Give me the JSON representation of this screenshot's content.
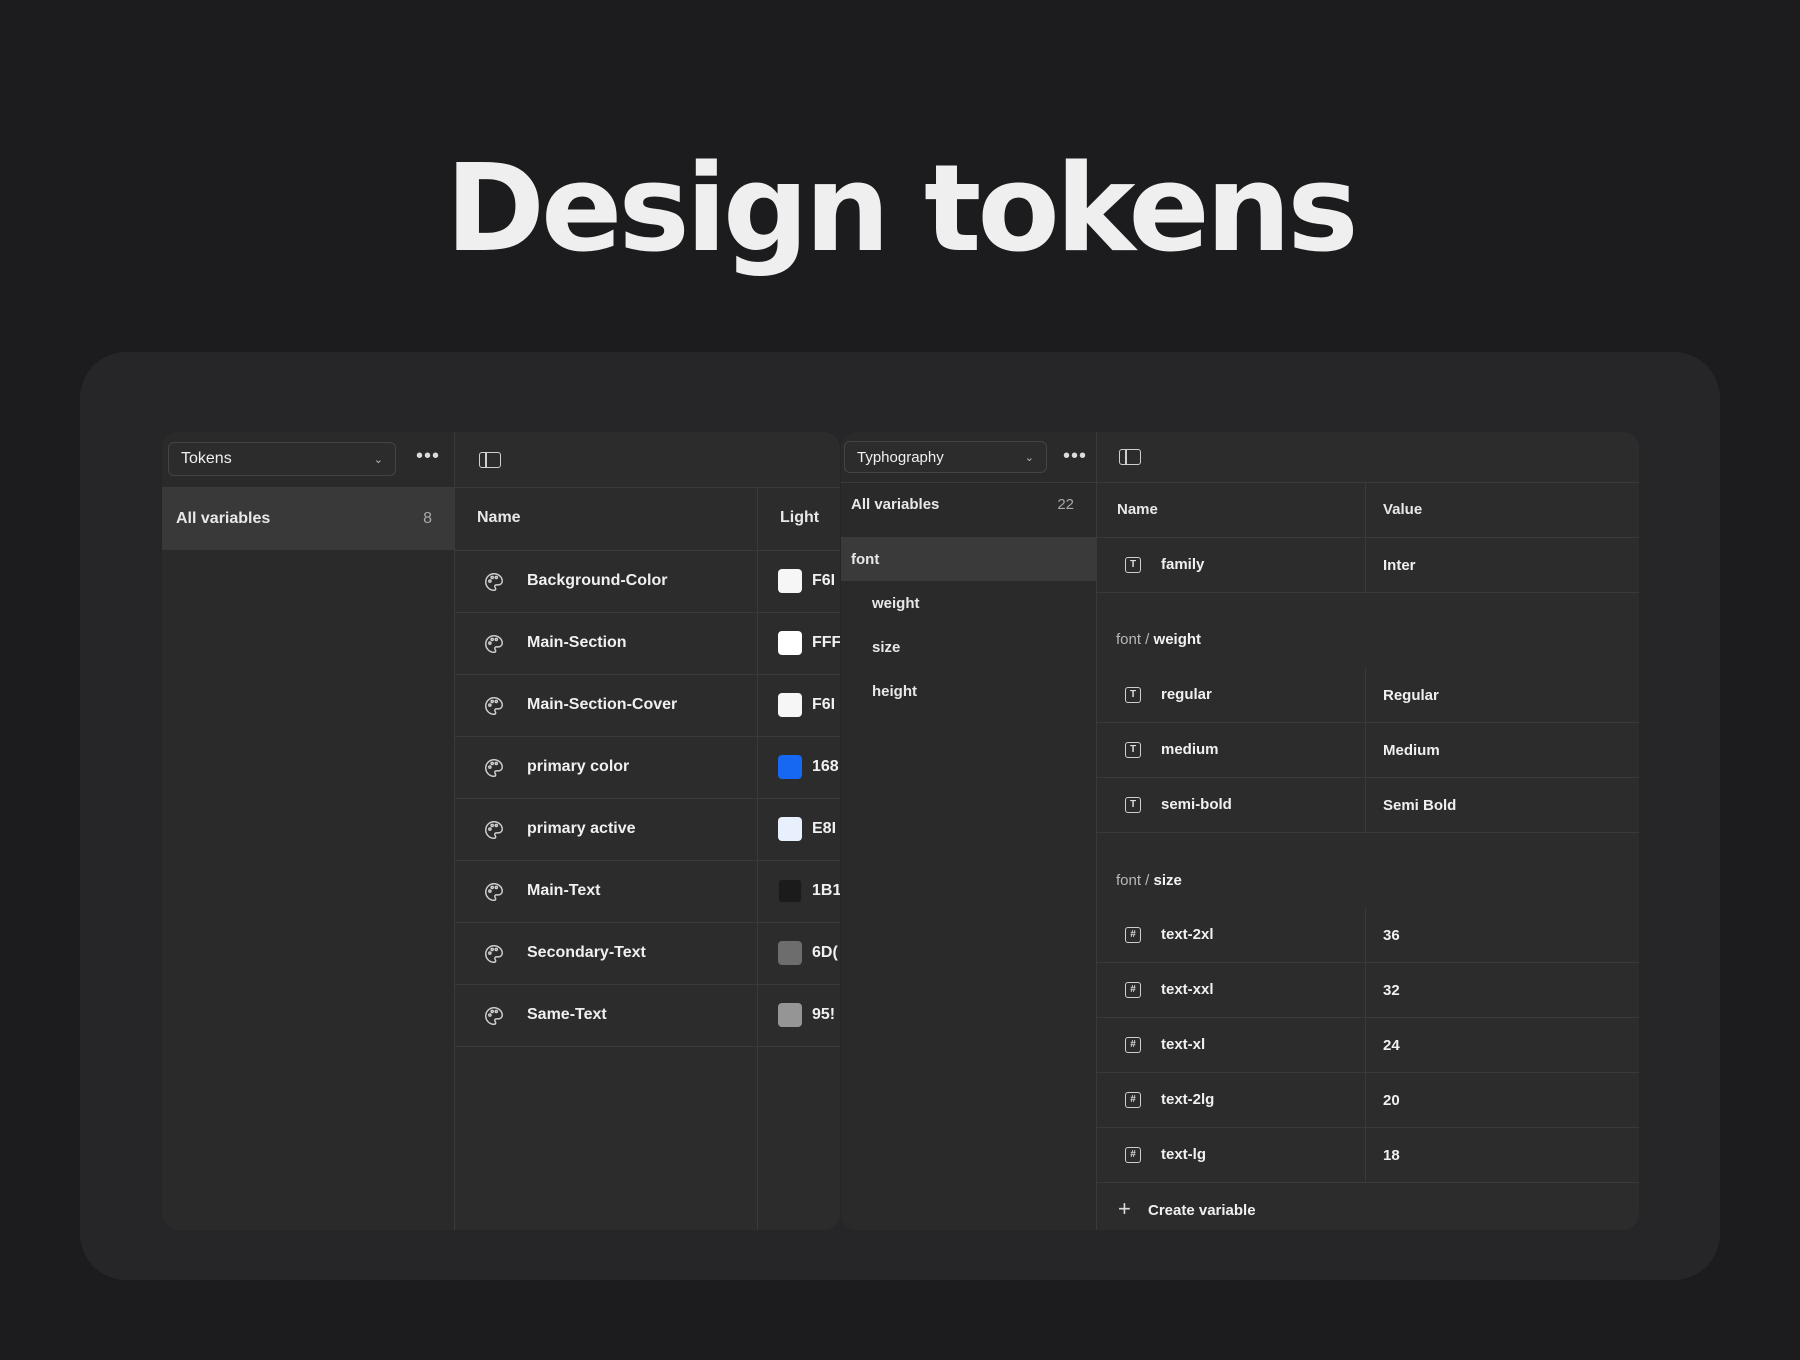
{
  "hero": {
    "title": "Design  tokens"
  },
  "tokens_panel": {
    "collection": "Tokens",
    "sidebar": {
      "label": "All variables",
      "count": "8"
    },
    "columns": {
      "name": "Name",
      "mode": "Light"
    },
    "variables": [
      {
        "name": "Background-Color",
        "value": "F6I",
        "color": "#F6F6F6"
      },
      {
        "name": "Main-Section",
        "value": "FFF",
        "color": "#FFFFFF"
      },
      {
        "name": "Main-Section-Cover",
        "value": "F6I",
        "color": "#F6F6F6"
      },
      {
        "name": "primary color",
        "value": "168",
        "color": "#1668F2"
      },
      {
        "name": "primary active",
        "value": "E8I",
        "color": "#E8F0FE"
      },
      {
        "name": "Main-Text",
        "value": "1B1",
        "color": "#1B1B1B"
      },
      {
        "name": "Secondary-Text",
        "value": "6D(",
        "color": "#6D6D6D"
      },
      {
        "name": "Same-Text",
        "value": "95!",
        "color": "#959595"
      }
    ]
  },
  "typography_panel": {
    "collection": "Typhography",
    "sidebar": {
      "label": "All variables",
      "count": "22",
      "groups": [
        "font",
        "weight",
        "size",
        "height"
      ]
    },
    "columns": {
      "name": "Name",
      "value": "Value"
    },
    "family_row": {
      "name": "family",
      "value": "Inter",
      "icon": "text-icon"
    },
    "weight_section": {
      "prefix": "font / ",
      "group": "weight",
      "rows": [
        {
          "name": "regular",
          "value": "Regular"
        },
        {
          "name": "medium",
          "value": "Medium"
        },
        {
          "name": "semi-bold",
          "value": "Semi Bold"
        }
      ]
    },
    "size_section": {
      "prefix": "font / ",
      "group": "size",
      "rows": [
        {
          "name": "text-2xl",
          "value": "36"
        },
        {
          "name": "text-xxl",
          "value": "32"
        },
        {
          "name": "text-xl",
          "value": "24"
        },
        {
          "name": "text-2lg",
          "value": "20"
        },
        {
          "name": "text-lg",
          "value": "18"
        }
      ]
    },
    "create_label": "Create variable"
  }
}
